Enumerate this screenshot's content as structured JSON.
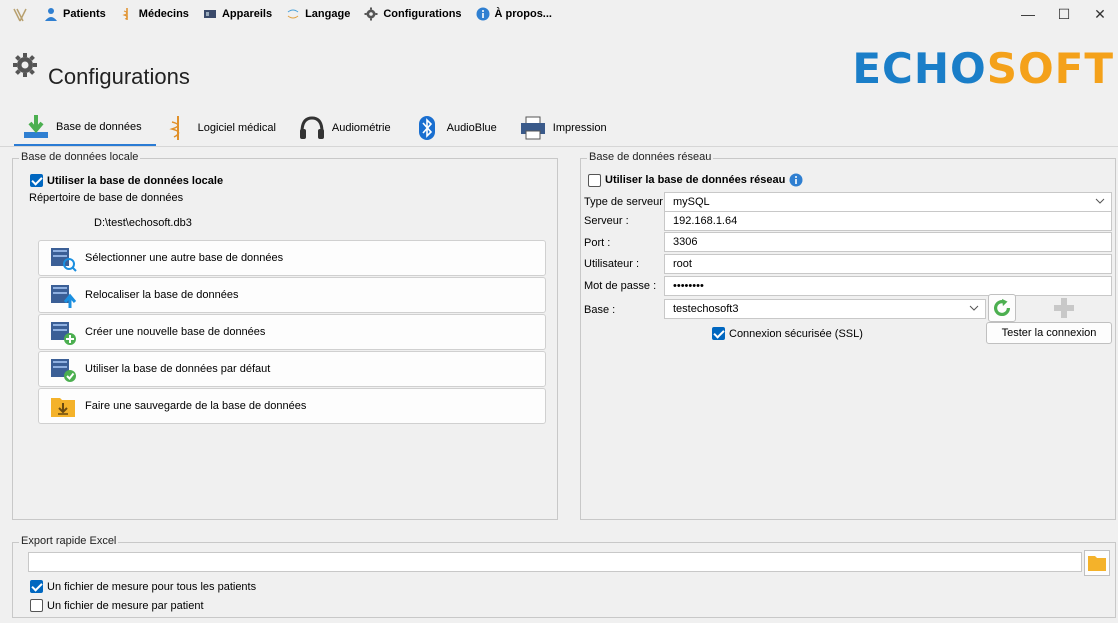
{
  "menubar": {
    "items": [
      {
        "label": "Patients",
        "icon": "user-icon"
      },
      {
        "label": "Médecins",
        "icon": "caduceus-icon"
      },
      {
        "label": "Appareils",
        "icon": "device-icon"
      },
      {
        "label": "Langage",
        "icon": "language-icon"
      },
      {
        "label": "Configurations",
        "icon": "gear-icon"
      },
      {
        "label": "À propos...",
        "icon": "info-icon"
      }
    ],
    "window_controls": {
      "minimize": "—",
      "maximize": "☐",
      "close": "✕"
    }
  },
  "header": {
    "title": "Configurations",
    "logo_part1": "ECHO",
    "logo_part2": "SOFT",
    "brand_blue": "#1a7ec8",
    "brand_orange": "#f4a11a"
  },
  "tabs": [
    {
      "label": "Base de données",
      "icon": "database-download-icon",
      "active": true
    },
    {
      "label": "Logiciel médical",
      "icon": "caduceus-icon",
      "active": false
    },
    {
      "label": "Audiométrie",
      "icon": "headphones-icon",
      "active": false
    },
    {
      "label": "AudioBlue",
      "icon": "bluetooth-icon",
      "active": false
    },
    {
      "label": "Impression",
      "icon": "printer-icon",
      "active": false
    }
  ],
  "local_db": {
    "group_title": "Base de données locale",
    "use_local_label": "Utiliser la base de données locale",
    "use_local_checked": true,
    "directory_label": "Répertoire de base de données",
    "directory_value": "D:\\test\\echosoft.db3",
    "buttons": [
      {
        "label": "Sélectionner une autre base de données",
        "icon": "db-search-icon"
      },
      {
        "label": "Relocaliser la base de données",
        "icon": "db-relocate-icon"
      },
      {
        "label": "Créer une nouvelle base de données",
        "icon": "db-add-icon"
      },
      {
        "label": "Utiliser la base de données par défaut",
        "icon": "db-check-icon"
      },
      {
        "label": "Faire une sauvegarde de la base de données",
        "icon": "folder-download-icon"
      }
    ]
  },
  "network_db": {
    "group_title": "Base de données réseau",
    "use_network_label": "Utiliser la base de données réseau",
    "use_network_checked": false,
    "server_type_label": "Type de serveur :",
    "server_type_value": "mySQL",
    "server_label": "Serveur :",
    "server_value": "192.168.1.64",
    "port_label": "Port :",
    "port_value": "3306",
    "user_label": "Utilisateur :",
    "user_value": "root",
    "password_label": "Mot de passe :",
    "password_value": "••••••••",
    "base_label": "Base :",
    "base_value": "testechosoft3",
    "ssl_label": "Connexion sécurisée (SSL)",
    "ssl_checked": true,
    "test_button": "Tester la connexion"
  },
  "export": {
    "group_title": "Export rapide Excel",
    "path_value": "",
    "option1_label": "Un fichier de mesure pour tous les patients",
    "option1_checked": true,
    "option2_label": "Un fichier de mesure par patient",
    "option2_checked": false
  }
}
